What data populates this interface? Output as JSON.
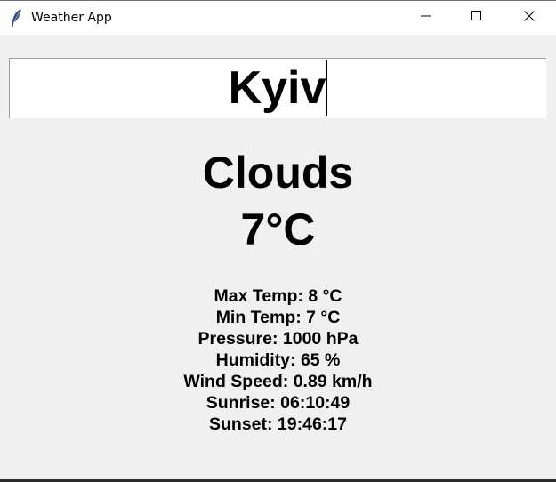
{
  "window": {
    "title": "Weather App",
    "app_icon": "feather-icon",
    "controls": {
      "minimize": "minimize-icon",
      "maximize": "maximize-icon",
      "close": "close-icon"
    }
  },
  "search": {
    "value": "Kyiv"
  },
  "weather": {
    "condition": "Clouds",
    "temperature": "7°C"
  },
  "details": {
    "max_temp": "Max Temp: 8 °C",
    "min_temp": "Min Temp: 7 °C",
    "pressure": "Pressure: 1000 hPa",
    "humidity": "Humidity: 65 %",
    "wind_speed": "Wind Speed: 0.89 km/h",
    "sunrise": "Sunrise: 06:10:49",
    "sunset": "Sunset: 19:46:17"
  },
  "colors": {
    "background": "#f0f0f0",
    "titlebar": "#ffffff",
    "text": "#000000",
    "input_bg": "#ffffff"
  }
}
